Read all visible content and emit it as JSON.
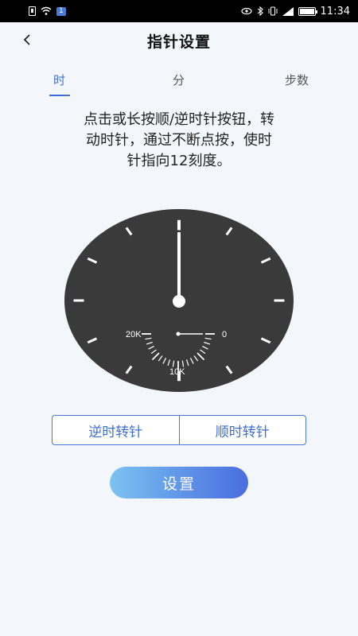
{
  "status_bar": {
    "sim_badge": "1",
    "time": "11:34"
  },
  "header": {
    "title": "指针设置",
    "back_icon": "chevron-left-icon"
  },
  "tabs": [
    {
      "label": "时",
      "active": true
    },
    {
      "label": "分",
      "active": false
    },
    {
      "label": "步数",
      "active": false
    }
  ],
  "instruction": "点击或长按顺/逆时针按钮，转动时针，通过不断点按，使时针指向12刻度。",
  "dial": {
    "sub_labels": {
      "left": "20K",
      "right": "0",
      "bottom": "10K"
    },
    "face_color": "#3a3a3a",
    "hand_color": "#ffffff"
  },
  "buttons": {
    "counter_clockwise": "逆时转针",
    "clockwise": "顺时转针",
    "set": "设置"
  },
  "colors": {
    "accent": "#3f6fd1",
    "background": "#f3f7fb"
  }
}
